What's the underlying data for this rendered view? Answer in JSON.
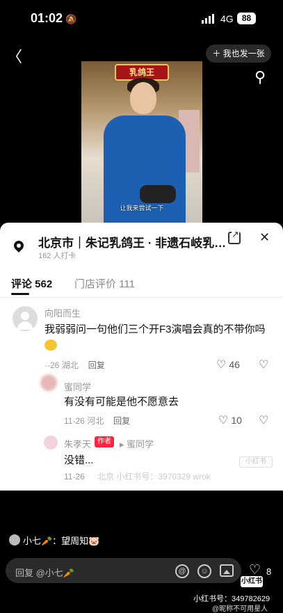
{
  "status_bar": {
    "time": "01:02",
    "network": "4G",
    "battery": "88"
  },
  "nav": {
    "back_icon": "chevron-left",
    "post_label": "＋ 我也发一张",
    "search_icon": "search"
  },
  "photo": {
    "shop_sign": "乳鸽王",
    "subtitle": "让我来尝试一下"
  },
  "sheet": {
    "location_title": "北京市｜朱记乳鸽王 · 非遗石岐乳…",
    "checkins": "162 人打卡",
    "tabs": [
      {
        "label": "评论 562",
        "active": true
      },
      {
        "label": "门店评价 111",
        "active": false
      }
    ],
    "comments": [
      {
        "user": "向阳而生",
        "text": "我弱弱问一句他们三个开F3演唱会真的不带你吗",
        "date": "·-26",
        "region": "湖北",
        "reply_label": "回复",
        "likes": "46"
      },
      {
        "user": "蜜同学",
        "text": "有没有可能是他不愿意去",
        "date": "11-26",
        "region": "河北",
        "reply_label": "回复",
        "likes": "10"
      },
      {
        "user": "朱孝天",
        "badge": "作者",
        "reply_to": "▸ 蜜同学",
        "text": "没错...",
        "date": "11-26",
        "region": "北京",
        "watermark": "小红书号：3970329 wrok",
        "tag": "小红书"
      }
    ]
  },
  "bottom": {
    "note": "小七🥕：望周知🐷",
    "reply_placeholder": "回复 @小七🥕",
    "like_count": "8",
    "logo": "小红书",
    "xhs_id": "小红书号：3497826​29",
    "weibo_watermark": "@昵称不可用星人"
  },
  "colors": {
    "accent": "#ff2442",
    "sheet_bg": "#ffffff",
    "page_bg": "#000000"
  }
}
